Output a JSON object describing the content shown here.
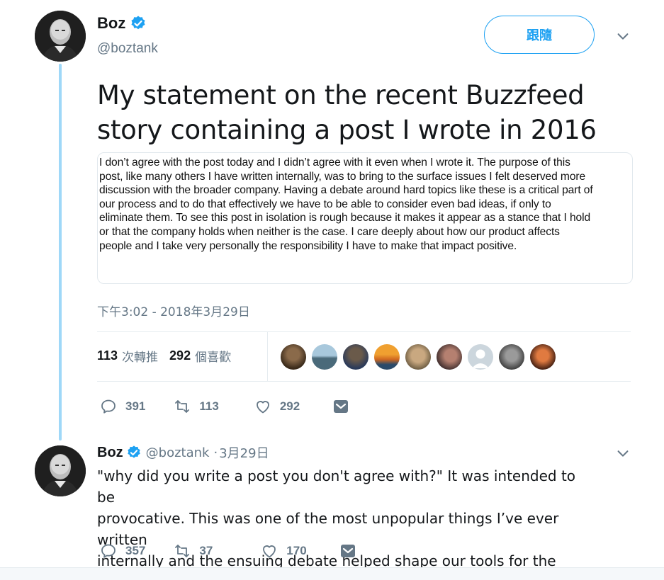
{
  "tweet": {
    "author_name": "Boz",
    "author_handle": "@boztank",
    "follow_label": "跟隨",
    "title": "My statement on the recent Buzzfeed story containing a post I wrote in 2016",
    "statement_lines": [
      "I don’t agree with the post today and I didn’t agree with it even when I wrote it. The purpose of this",
      "post, like many others I have written internally, was to bring to the surface issues I felt deserved more",
      "discussion with the broader company. Having a debate around hard topics like these is a critical part of",
      "our process and to do that effectively we have to be able to consider even bad ideas, if only to",
      "eliminate them. To see this post in isolation is rough because it makes it appear as a stance that I hold",
      "or that the company holds when neither is the case. I care deeply about how our product affects",
      "people and I take very personally the responsibility I have to make that impact positive."
    ],
    "timestamp": "下午3:02 - 2018年3月29日",
    "retweets_count": "113",
    "retweets_label": "次轉推",
    "likes_count": "292",
    "likes_label": "個喜歡",
    "liker_avatars": [
      "#5a4a3a",
      "#6a8fa8",
      "#3d3a37",
      "#d9882e",
      "#b9a58a",
      "#7b5a52",
      "#b8c4cc",
      "#5d5d5d",
      "#d1551e"
    ],
    "actions": {
      "reply_count": "391",
      "retweet_count": "113",
      "like_count": "292"
    }
  },
  "reply": {
    "author_name": "Boz",
    "author_handle": "@boztank",
    "separator": "·",
    "date": "3月29日",
    "text_lines": [
      "\"why did you write a post you don't agree with?\" It was intended to be",
      "provocative. This was one of the most unpopular things I’ve ever written",
      "internally and the ensuing debate helped shape our tools for the better."
    ],
    "actions": {
      "reply_count": "357",
      "retweet_count": "37",
      "like_count": "170"
    }
  },
  "colors": {
    "accent": "#1da1f2",
    "muted": "#657786",
    "thread_line": "#9fd8f8",
    "dm_icon": "#657786"
  }
}
